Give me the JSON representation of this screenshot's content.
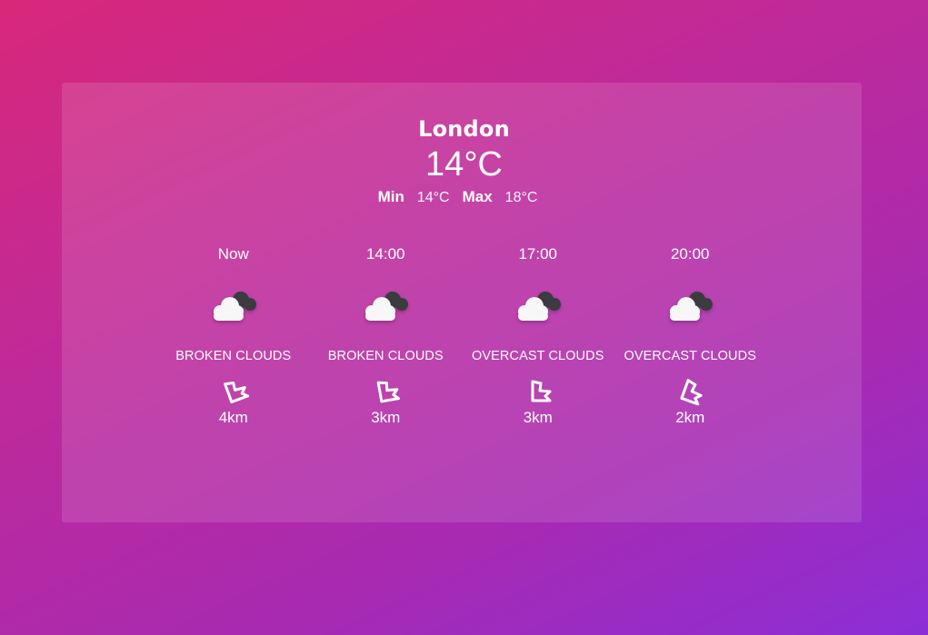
{
  "weather": {
    "city": "London",
    "current_temp": "14°C",
    "min_label": "Min",
    "min_value": "14°C",
    "max_label": "Max",
    "max_value": "18°C"
  },
  "forecast": [
    {
      "time": "Now",
      "icon": "broken-clouds-icon",
      "description": "BROKEN CLOUDS",
      "wind_icon": "wind-direction-icon",
      "wind_distance": "4km"
    },
    {
      "time": "14:00",
      "icon": "broken-clouds-icon",
      "description": "BROKEN CLOUDS",
      "wind_icon": "wind-direction-icon",
      "wind_distance": "3km"
    },
    {
      "time": "17:00",
      "icon": "overcast-clouds-icon",
      "description": "OVERCAST CLOUDS",
      "wind_icon": "wind-direction-icon",
      "wind_distance": "3km"
    },
    {
      "time": "20:00",
      "icon": "overcast-clouds-icon",
      "description": "OVERCAST CLOUDS",
      "wind_icon": "wind-direction-icon",
      "wind_distance": "2km"
    }
  ],
  "colors": {
    "gradient_start": "#d8287a",
    "gradient_end": "#8c2ed6",
    "text": "#ffffff"
  }
}
